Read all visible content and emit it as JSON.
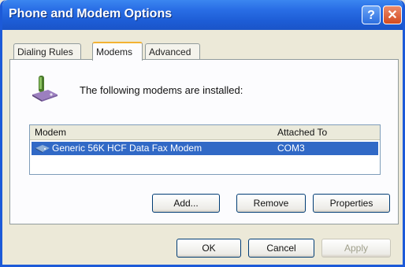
{
  "window": {
    "title": "Phone and Modem Options"
  },
  "tabs": [
    {
      "label": "Dialing Rules"
    },
    {
      "label": "Modems"
    },
    {
      "label": "Advanced"
    }
  ],
  "modems_tab": {
    "intro_text": "The following modems are installed:",
    "columns": {
      "modem": "Modem",
      "attached_to": "Attached To"
    },
    "rows": [
      {
        "modem": "Generic 56K HCF Data Fax Modem",
        "attached_to": "COM3",
        "selected": true
      }
    ],
    "buttons": {
      "add": "Add...",
      "remove": "Remove",
      "properties": "Properties"
    }
  },
  "footer": {
    "ok": "OK",
    "cancel": "Cancel",
    "apply": "Apply"
  },
  "colors": {
    "title_bar": "#1d5dd6",
    "selection": "#3169c6",
    "dialog_bg": "#ece9d8"
  },
  "icons": {
    "help": "help-icon",
    "close": "close-icon",
    "modem": "modem-phone-icon"
  }
}
